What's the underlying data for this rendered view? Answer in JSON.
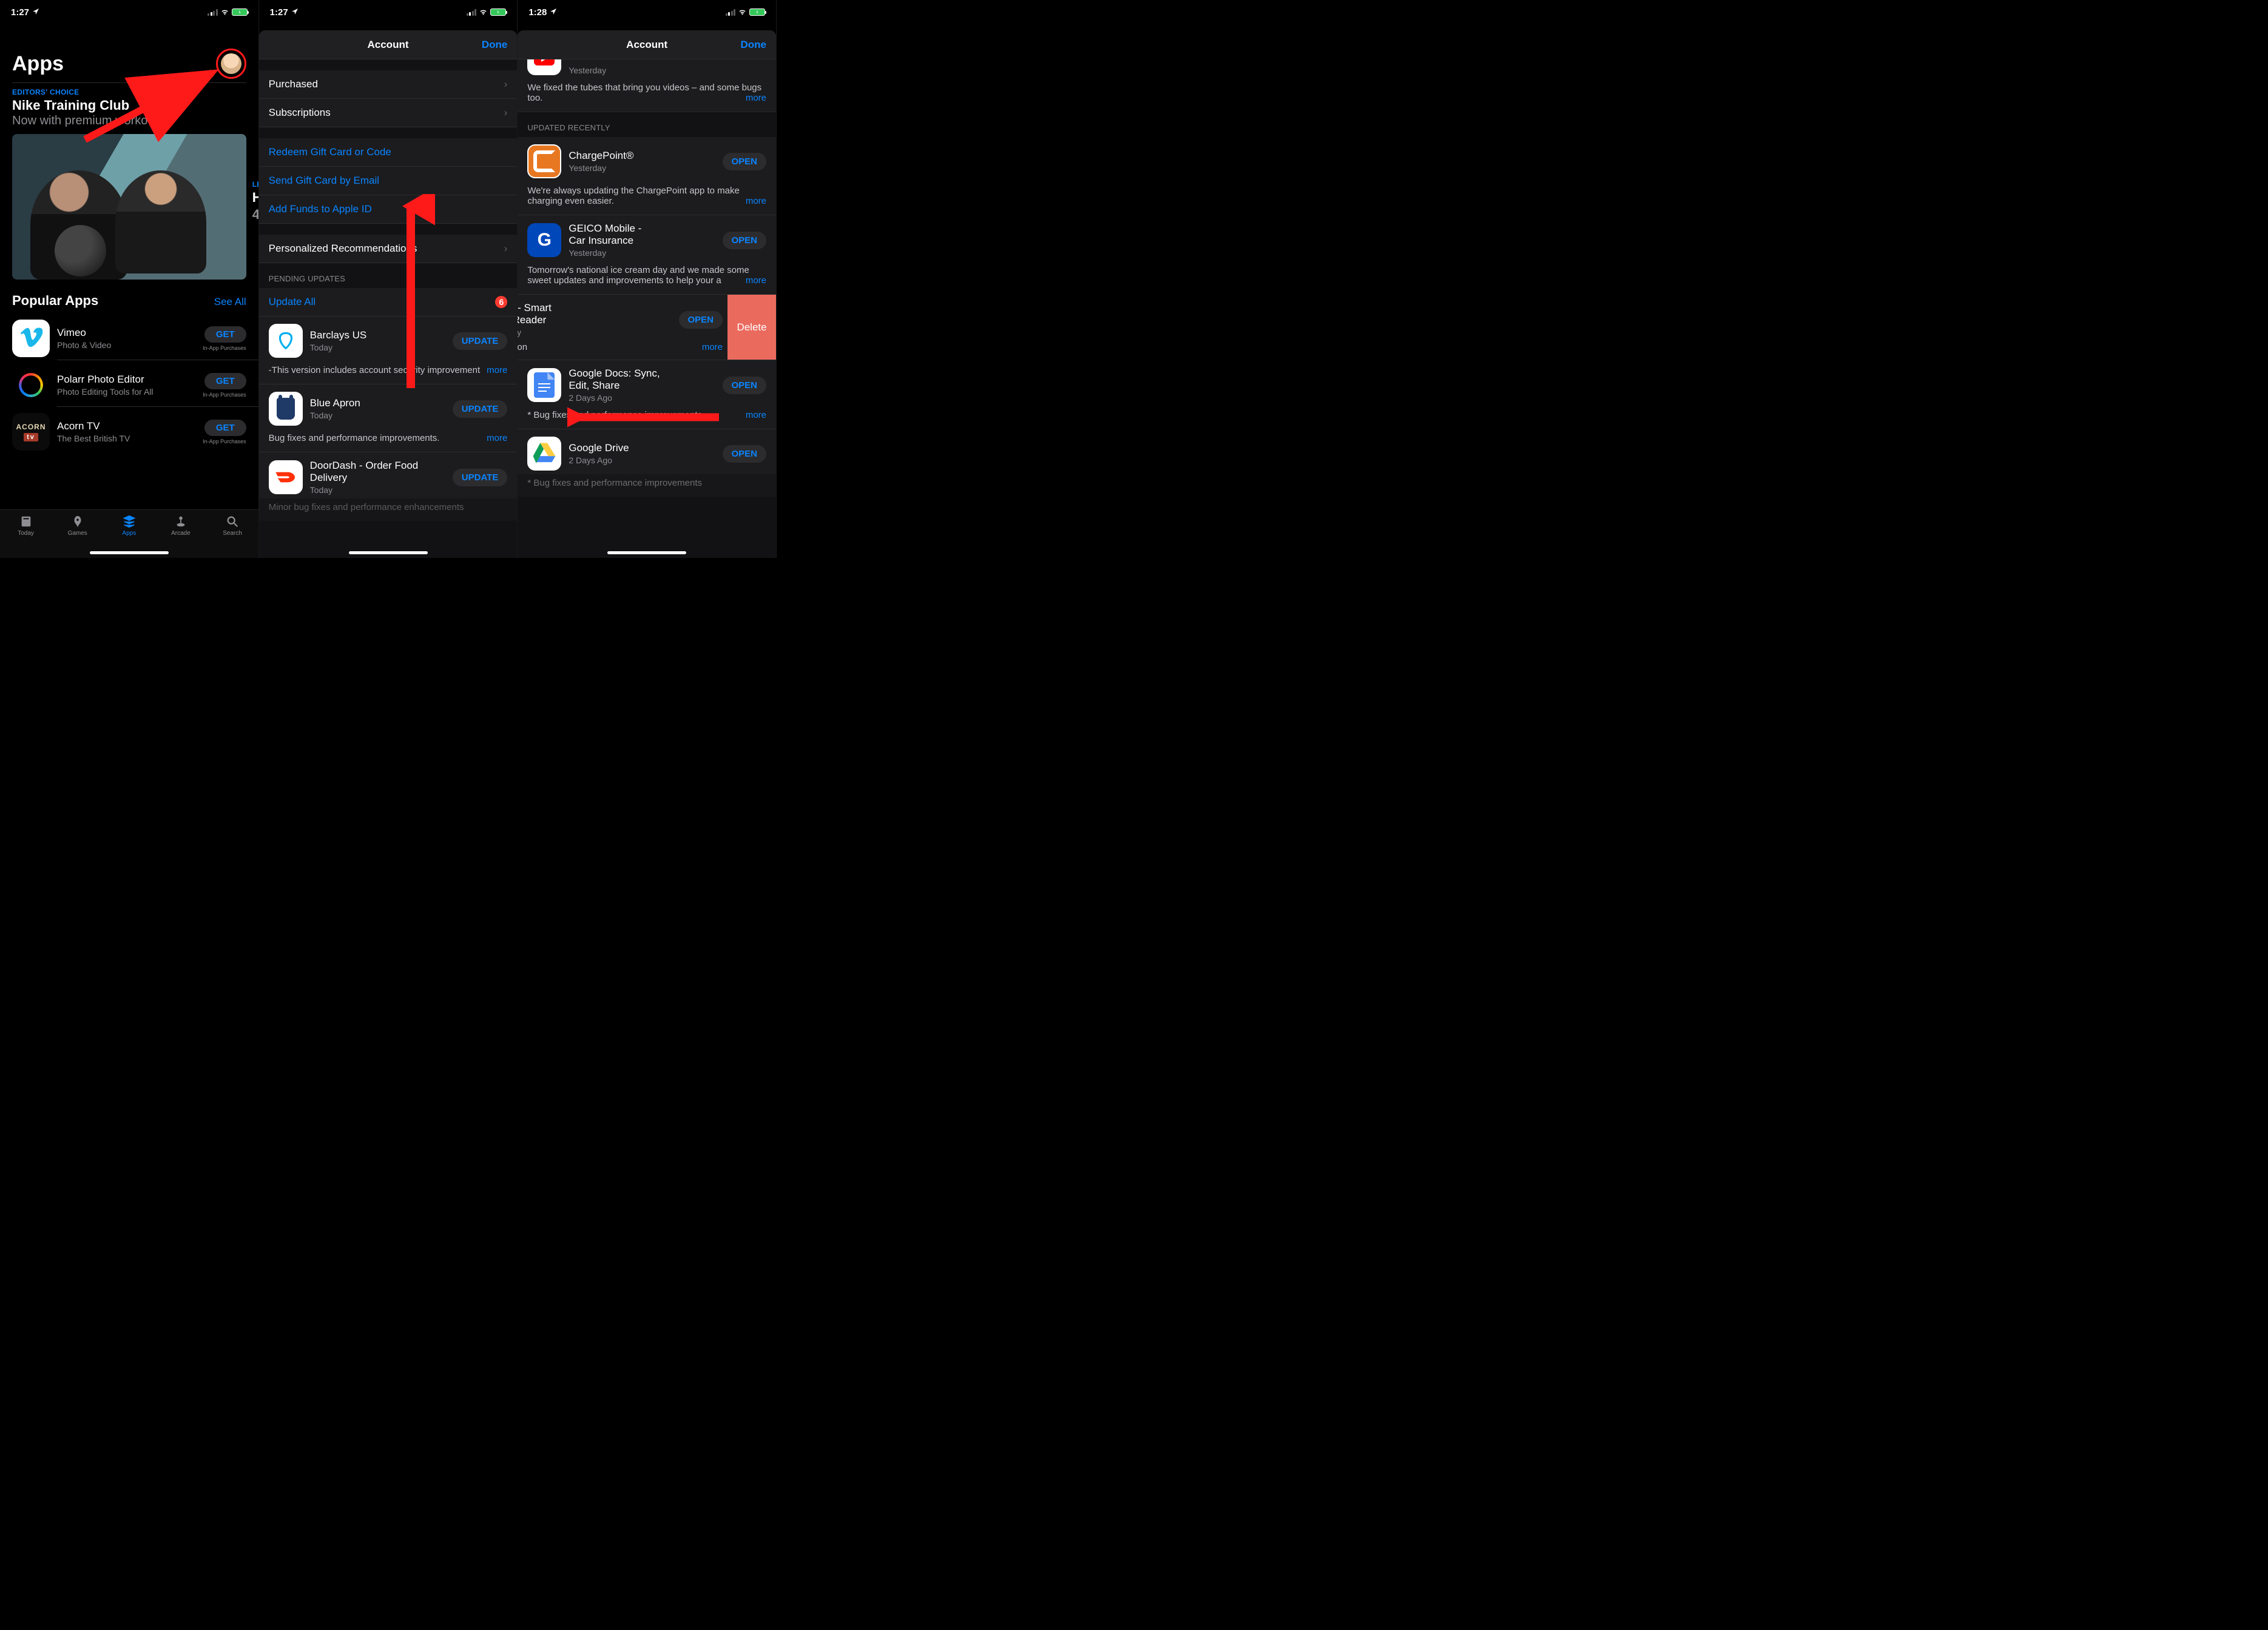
{
  "screen1": {
    "status": {
      "time": "1:27"
    },
    "header": {
      "title": "Apps"
    },
    "feature": {
      "eyebrow": "EDITORS' CHOICE",
      "title": "Nike Training Club",
      "subtitle": "Now with premium workouts",
      "peek_eyebrow": "LE",
      "peek_title": "H",
      "peek_line2": "4"
    },
    "popular": {
      "title": "Popular Apps",
      "see_all": "See All",
      "apps": [
        {
          "name": "Vimeo",
          "subtitle": "Photo & Video",
          "action": "GET",
          "iap": "In-App Purchases"
        },
        {
          "name": "Polarr Photo Editor",
          "subtitle": "Photo Editing Tools for All",
          "action": "GET",
          "iap": "In-App Purchases"
        },
        {
          "name": "Acorn TV",
          "subtitle": "The Best British TV",
          "action": "GET",
          "iap": "In-App Purchases"
        }
      ]
    },
    "tabs": {
      "today": "Today",
      "games": "Games",
      "apps": "Apps",
      "arcade": "Arcade",
      "search": "Search"
    }
  },
  "screen2": {
    "status": {
      "time": "1:27"
    },
    "nav": {
      "title": "Account",
      "done": "Done"
    },
    "rows": {
      "purchased": "Purchased",
      "subscriptions": "Subscriptions",
      "redeem": "Redeem Gift Card or Code",
      "send_gift": "Send Gift Card by Email",
      "add_funds": "Add Funds to Apple ID",
      "personalized": "Personalized Recommendations"
    },
    "pending": {
      "header": "PENDING UPDATES",
      "update_all": "Update All",
      "count": "6",
      "apps": [
        {
          "name": "Barclays US",
          "when": "Today",
          "action": "UPDATE",
          "notes": "-This version includes account security improvements.",
          "more": "more"
        },
        {
          "name": "Blue Apron",
          "when": "Today",
          "action": "UPDATE",
          "notes": "Bug fixes and performance improvements.",
          "more": "more"
        },
        {
          "name": "DoorDash - Order Food Delivery",
          "when": "Today",
          "action": "UPDATE",
          "notes": "Minor bug fixes and performance enhancements",
          "more": ""
        }
      ]
    }
  },
  "screen3": {
    "status": {
      "time": "1:28"
    },
    "nav": {
      "title": "Account",
      "done": "Done"
    },
    "youtube": {
      "when": "Yesterday",
      "notes": "We fixed the tubes that bring you videos – and some bugs too.",
      "more": "more"
    },
    "recent_header": "UPDATED RECENTLY",
    "apps": [
      {
        "name": "ChargePoint®",
        "when": "Yesterday",
        "action": "OPEN",
        "notes": "We're always updating the ChargePoint app to make charging even easier.",
        "more": "more"
      },
      {
        "name": "GEICO Mobile - Car Insurance",
        "when": "Yesterday",
        "action": "OPEN",
        "notes": "Tomorrow's national ice cream day and we made some sweet updates and improvements to help your a",
        "more": "more"
      },
      {
        "name": "Feedly - Smart News Reader",
        "when": "Yesterday",
        "action": "OPEN",
        "notes": "otimization",
        "more": "more",
        "delete": "Delete"
      },
      {
        "name": "Google Docs: Sync, Edit, Share",
        "when": "2 Days Ago",
        "action": "OPEN",
        "notes": "* Bug fixes and performance improvements",
        "more": "more"
      },
      {
        "name": "Google Drive",
        "when": "2 Days Ago",
        "action": "OPEN",
        "notes": "* Bug fixes and performance improvements",
        "more": ""
      }
    ]
  }
}
